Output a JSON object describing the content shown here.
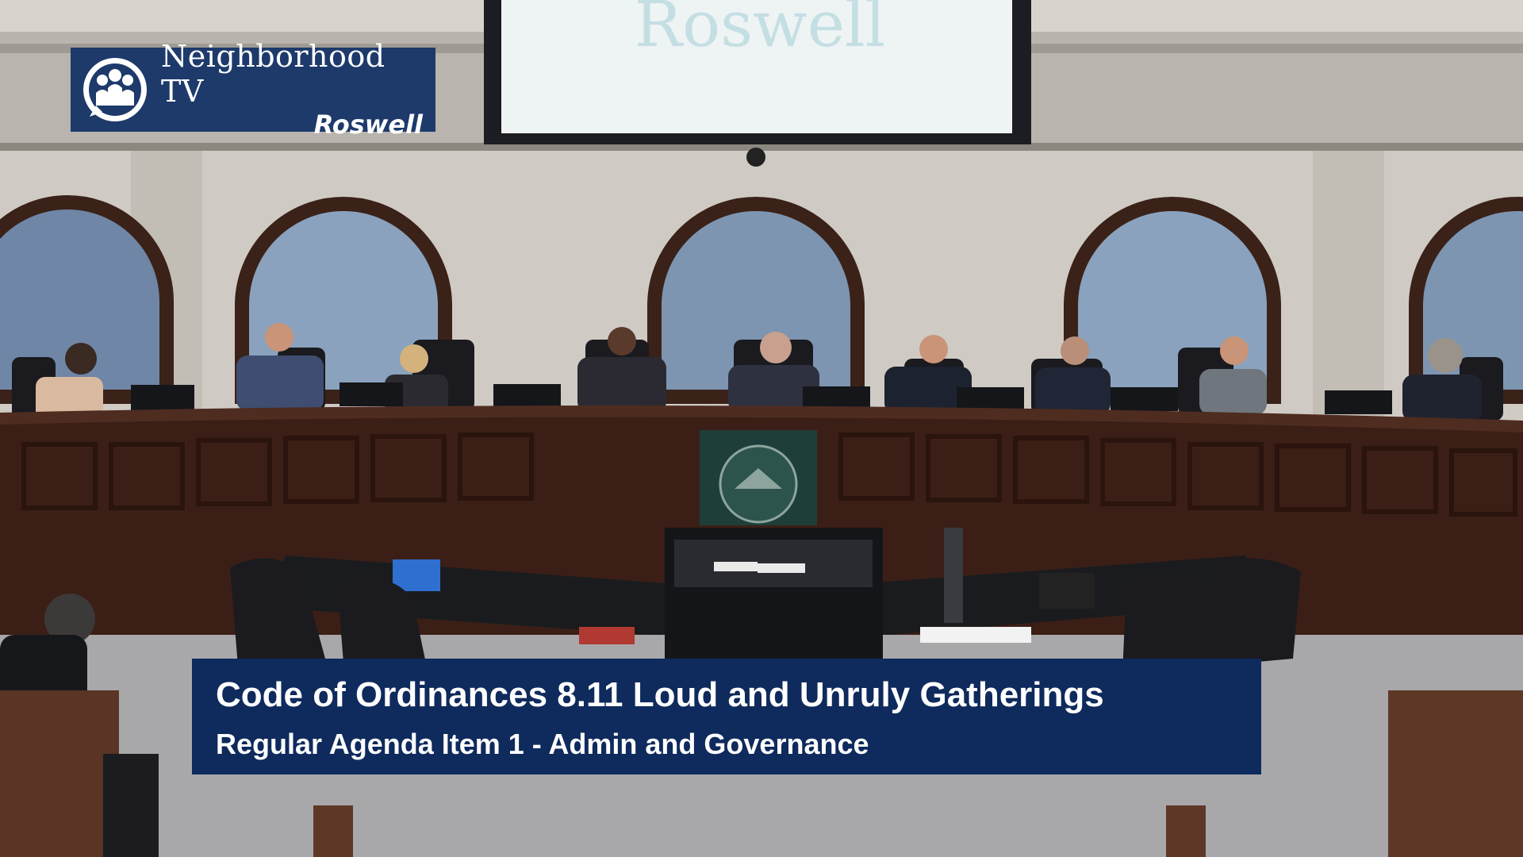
{
  "video": {
    "screen_text": "Roswell"
  },
  "logo": {
    "line1": "Neighborhood TV",
    "line2": "Roswell",
    "icon": "people-icon"
  },
  "lower_third": {
    "title": "Code of Ordinances 8.11 Loud and Unruly Gatherings",
    "subtitle": "Regular Agenda Item 1 - Admin and Governance"
  },
  "colors": {
    "logo_bg": "#1d3a6b",
    "lower_third_bg": "#0f2a5c",
    "dais_wood": "#3b1f16"
  }
}
